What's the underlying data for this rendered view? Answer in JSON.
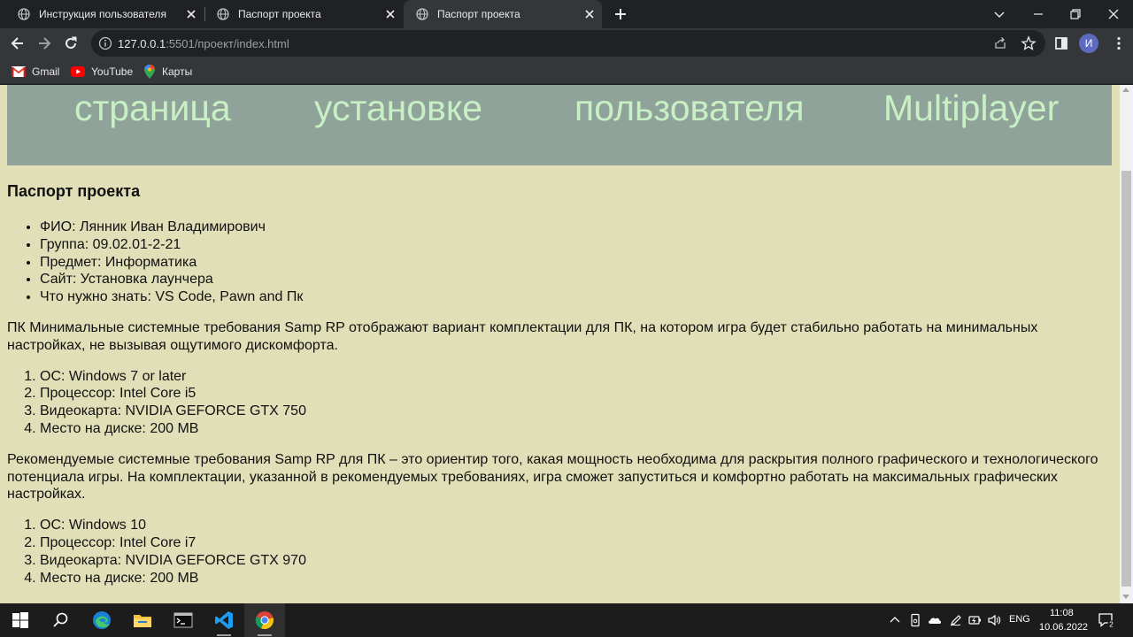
{
  "browser": {
    "tabs": [
      {
        "title": "Инструкция пользователя",
        "active": false
      },
      {
        "title": "Паспорт проекта",
        "active": false
      },
      {
        "title": "Паспорт проекта",
        "active": true
      }
    ],
    "url_host": "127.0.0.1",
    "url_path": ":5501/проект/index.html",
    "profile_initial": "И",
    "bookmarks": [
      "Gmail",
      "YouTube",
      "Карты"
    ]
  },
  "page": {
    "hero_words": [
      "страница",
      "установке",
      "пользователя",
      "Multiplayer"
    ],
    "heading": "Паспорт проекта",
    "passport_items": [
      "ФИО: Лянник Иван Владимирович",
      "Группа: 09.02.01-2-21",
      "Предмет: Информатика",
      "Сайт: Установка лаунчера",
      "Что нужно знать: VS Code, Pawn and Пк"
    ],
    "min_paragraph": "ПК Минимальные системные требования Samp RP отображают вариант комплектации для ПК, на котором игра будет стабильно работать на минимальных настройках, не вызывая ощутимого дискомфорта.",
    "min_requirements": [
      "ОС: Windows 7 or later",
      "Процессор: Intel Core i5",
      "Видеокарта: NVIDIA GEFORCE GTX 750",
      "Место на диске: 200 MB"
    ],
    "rec_paragraph": "Рекомендуемые системные требования Samp RP для ПК – это ориентир того, какая мощность необходима для раскрытия полного графического и технологического потенциала игры. На комплектации, указанной в рекомендуемых требованиях, игра сможет запуститься и комфортно работать на максимальных графических настройках.",
    "rec_requirements": [
      "ОС: Windows 10",
      "Процессор: Intel Core i7",
      "Видеокарта: NVIDIA GEFORCE GTX 970",
      "Место на диске: 200 MB"
    ]
  },
  "taskbar": {
    "language": "ENG",
    "time": "11:08",
    "date": "10.06.2022",
    "notification_count": "2"
  },
  "colors": {
    "page_background": "#e0dfb8",
    "hero_background": "#8fa39a",
    "hero_text": "#c9f0c4"
  }
}
